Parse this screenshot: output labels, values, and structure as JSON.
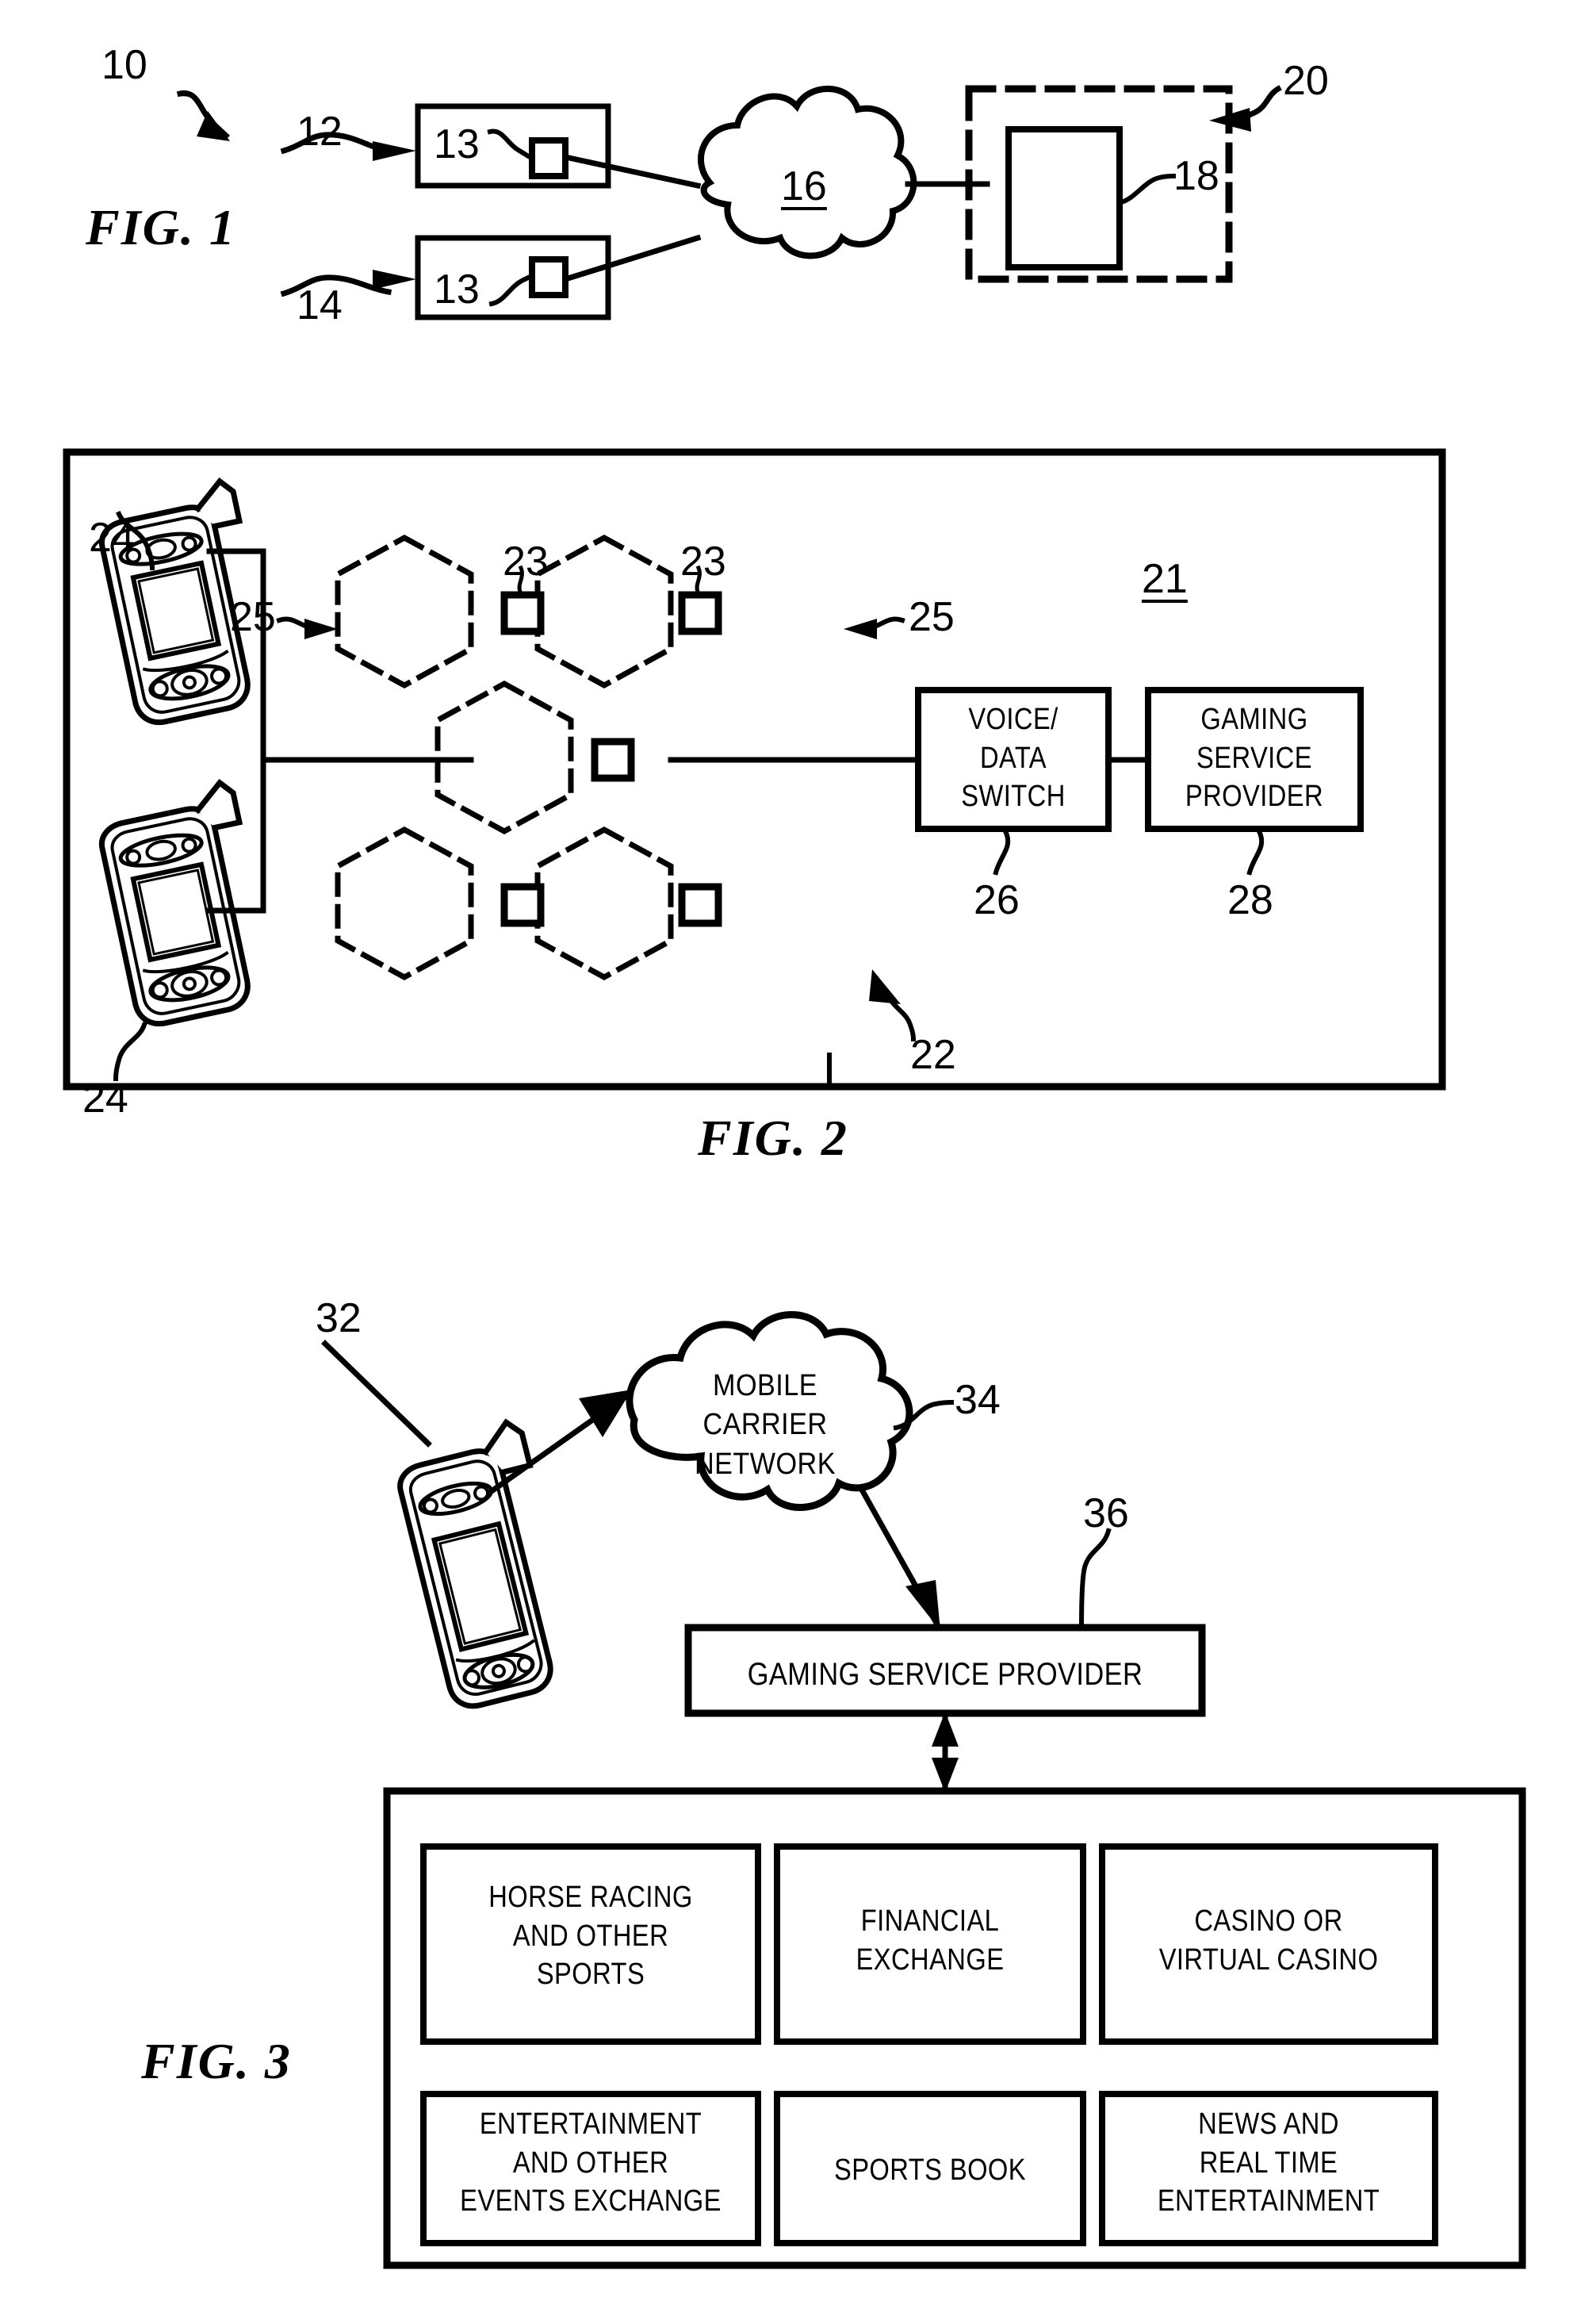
{
  "figures": [
    {
      "caption": "FIG. 1",
      "reference_numerals": [
        "10",
        "12",
        "13",
        "14",
        "16",
        "18",
        "20"
      ],
      "elements": {
        "terminal_a_inner_label": "13",
        "terminal_b_inner_label": "13",
        "network_cloud_label": "16",
        "server_label": "18",
        "system_label": "10",
        "terminal_a_label": "12",
        "terminal_b_label": "14",
        "boundary_label": "20"
      }
    },
    {
      "caption": "FIG. 2",
      "reference_numerals": [
        "21",
        "22",
        "23",
        "24",
        "25",
        "26",
        "28"
      ],
      "elements": {
        "system_label": "21",
        "cellular_network_label": "22",
        "base_station_label_left": "23",
        "base_station_label_right": "23",
        "handset_label_top": "24",
        "handset_label_bottom": "24",
        "cell_label_left": "25",
        "cell_label_right": "25",
        "switch_label": "26",
        "provider_label": "28"
      },
      "boxes": [
        {
          "name": "voice-data-switch",
          "text": "VOICE/\nDATA\nSWITCH"
        },
        {
          "name": "gaming-service-provider",
          "text": "GAMING\nSERVICE\nPROVIDER"
        }
      ]
    },
    {
      "caption": "FIG. 3",
      "reference_numerals": [
        "32",
        "34",
        "36"
      ],
      "elements": {
        "handset_label": "32",
        "network_label": "34",
        "provider_label": "36"
      },
      "cloud_text": "MOBILE CARRIER\nNETWORK",
      "provider_text": "GAMING SERVICE PROVIDER",
      "services": [
        {
          "name": "horse-racing-and-other-sports",
          "text": "HORSE RACING\nAND OTHER\nSPORTS"
        },
        {
          "name": "financial-exchange",
          "text": "FINANCIAL\nEXCHANGE"
        },
        {
          "name": "casino-or-virtual-casino",
          "text": "CASINO OR\nVIRTUAL CASINO"
        },
        {
          "name": "entertainment-and-other-events-exchange",
          "text": "ENTERTAINMENT\nAND OTHER\nEVENTS EXCHANGE"
        },
        {
          "name": "sports-book",
          "text": "SPORTS BOOK"
        },
        {
          "name": "news-and-real-time-entertainment",
          "text": "NEWS AND\nREAL TIME\nENTERTAINMENT"
        }
      ]
    }
  ],
  "colors": {
    "ink": "#000000",
    "paper": "#ffffff"
  }
}
